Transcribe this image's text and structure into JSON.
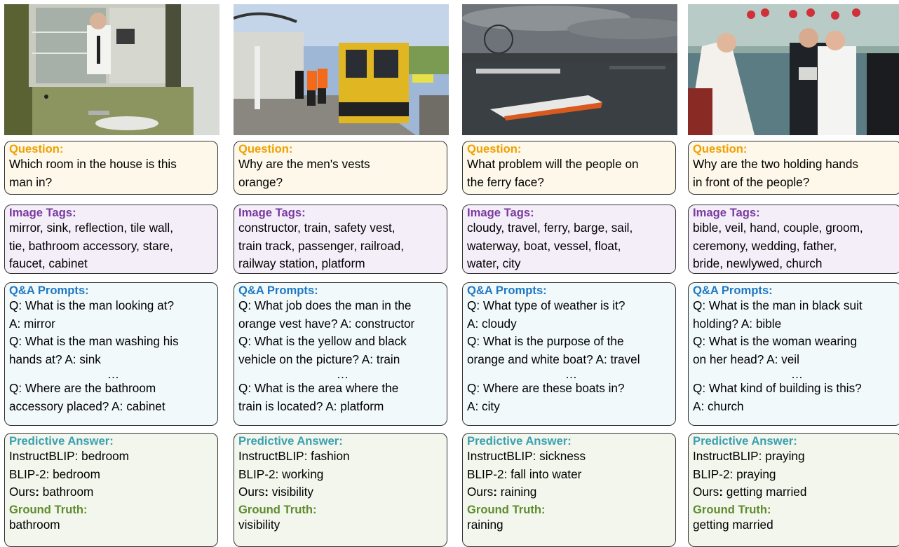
{
  "labels": {
    "question": "Question:",
    "tags": "Image Tags:",
    "prompts": "Q&A Prompts:",
    "predictive": "Predictive Answer:",
    "ground_truth": "Ground Truth:",
    "ellipsis": "…"
  },
  "columns": [
    {
      "photo": "bathroom-mirror-photo",
      "question": [
        "Which room in the house is this",
        "man in?"
      ],
      "tags": [
        "mirror, sink, reflection, tile wall,",
        "tie, bathroom accessory, stare,",
        "faucet, cabinet"
      ],
      "prompts_before": [
        "Q: What is the man looking at?",
        "A: mirror",
        "Q: What is the man washing his",
        "hands at? A: sink"
      ],
      "prompts_after": [
        "Q: Where are the bathroom",
        "accessory placed?  A: cabinet"
      ],
      "instructblip": "InstructBLIP: bedroom",
      "blip2": "BLIP-2: bedroom",
      "ours_label": "Ours",
      "ours_colon": ":",
      "ours_value": " bathroom",
      "ground_truth": "bathroom"
    },
    {
      "photo": "train-platform-photo",
      "question": [
        "Why are the men's vests",
        "orange?"
      ],
      "tags": [
        "constructor, train, safety vest,",
        "train track, passenger, railroad,",
        "railway station, platform"
      ],
      "prompts_before": [
        "Q: What job does the man in the",
        "orange vest have? A: constructor",
        "Q: What is the yellow and black",
        "vehicle on the picture? A: train"
      ],
      "prompts_after": [
        "Q: What is the area where the",
        "train is located? A: platform"
      ],
      "instructblip": "InstructBLIP: fashion",
      "blip2": "BLIP-2: working",
      "ours_label": "Ours",
      "ours_colon": ":",
      "ours_value": " visibility",
      "ground_truth": "visibility"
    },
    {
      "photo": "river-ferry-photo",
      "question": [
        "What problem will the people on",
        "the ferry face?"
      ],
      "tags": [
        "cloudy, travel, ferry, barge, sail,",
        "waterway, boat, vessel, float,",
        "water, city"
      ],
      "prompts_before": [
        "Q: What type of weather is it?",
        "A: cloudy",
        "Q: What is the purpose of the",
        "orange and white boat? A: travel"
      ],
      "prompts_after": [
        "Q: Where are these boats in?",
        "A: city"
      ],
      "instructblip": "InstructBLIP: sickness",
      "blip2": "BLIP-2: fall into water",
      "ours_label": "Ours",
      "ours_colon": ":",
      "ours_value": " raining",
      "ground_truth": "raining"
    },
    {
      "photo": "wedding-ceremony-photo",
      "question": [
        "Why are the two holding hands",
        "in front of the people?"
      ],
      "tags": [
        "bible, veil, hand, couple, groom,",
        "ceremony, wedding, father,",
        "bride, newlywed, church"
      ],
      "prompts_before": [
        "Q: What is the man in black suit",
        "holding? A: bible",
        "Q: What is the woman wearing",
        "on her head? A: veil"
      ],
      "prompts_after": [
        "Q: What kind of building is this?",
        "A: church"
      ],
      "instructblip": "InstructBLIP: praying",
      "blip2": "BLIP-2: praying",
      "ours_label": "Ours",
      "ours_colon": ":",
      "ours_value": " getting married",
      "ground_truth": "getting married"
    }
  ]
}
